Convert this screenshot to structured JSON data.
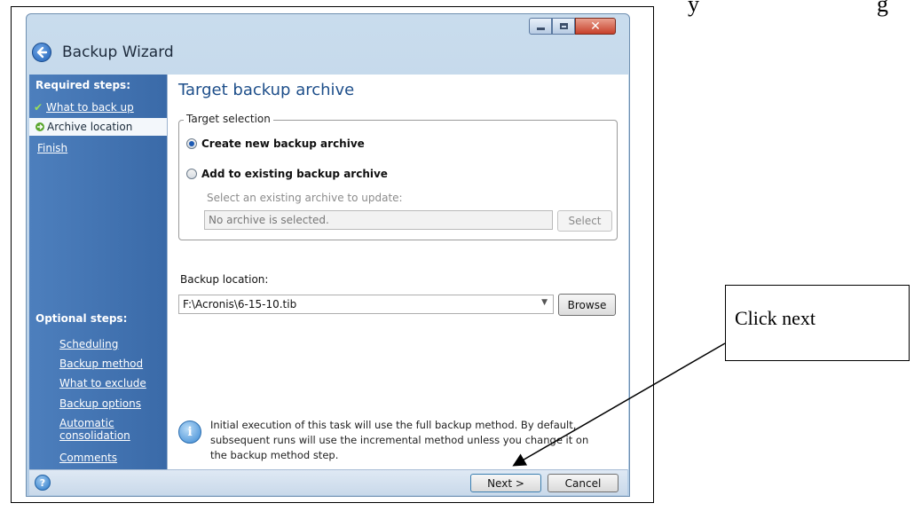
{
  "page": {
    "top_partial_text": "y",
    "top_partial_text_2": "g"
  },
  "window": {
    "title": "Backup Wizard",
    "controls": {
      "minimize": "minimize",
      "maximize": "maximize",
      "close": "✕"
    }
  },
  "sidebar": {
    "required_heading": "Required steps:",
    "required_items": [
      {
        "label": "What to back up",
        "state": "done"
      },
      {
        "label": "Archive location",
        "state": "active"
      },
      {
        "label": "Finish",
        "state": "pending"
      }
    ],
    "optional_heading": "Optional steps:",
    "optional_items": [
      {
        "label": "Scheduling"
      },
      {
        "label": "Backup method"
      },
      {
        "label": "What to exclude"
      },
      {
        "label": "Backup options"
      },
      {
        "label": "Automatic consolidation",
        "line1": "Automatic",
        "line2": "consolidation"
      },
      {
        "label": "Comments"
      }
    ]
  },
  "main": {
    "title": "Target backup archive",
    "target_selection": {
      "legend": "Target selection",
      "option_new": "Create new backup archive",
      "option_existing": "Add to existing backup archive",
      "selected": "option_new",
      "existing_prompt": "Select an existing archive to update:",
      "archive_value": "No archive is selected.",
      "select_button": "Select"
    },
    "backup_location": {
      "label": "Backup location:",
      "value": "F:\\Acronis\\6-15-10.tib",
      "browse_button": "Browse"
    },
    "info": {
      "line1": "Initial execution of this task will use the full backup method. By default,",
      "line2": "subsequent runs will use the incremental method unless you change it on",
      "line3": "the backup method step."
    }
  },
  "footer": {
    "next_button": "Next >",
    "cancel_button": "Cancel"
  },
  "callout": {
    "text": "Click next"
  },
  "colors": {
    "sidebar": "#3a6aa8",
    "title_blue": "#1d4e8a",
    "window_frame": "#b4cde6"
  }
}
